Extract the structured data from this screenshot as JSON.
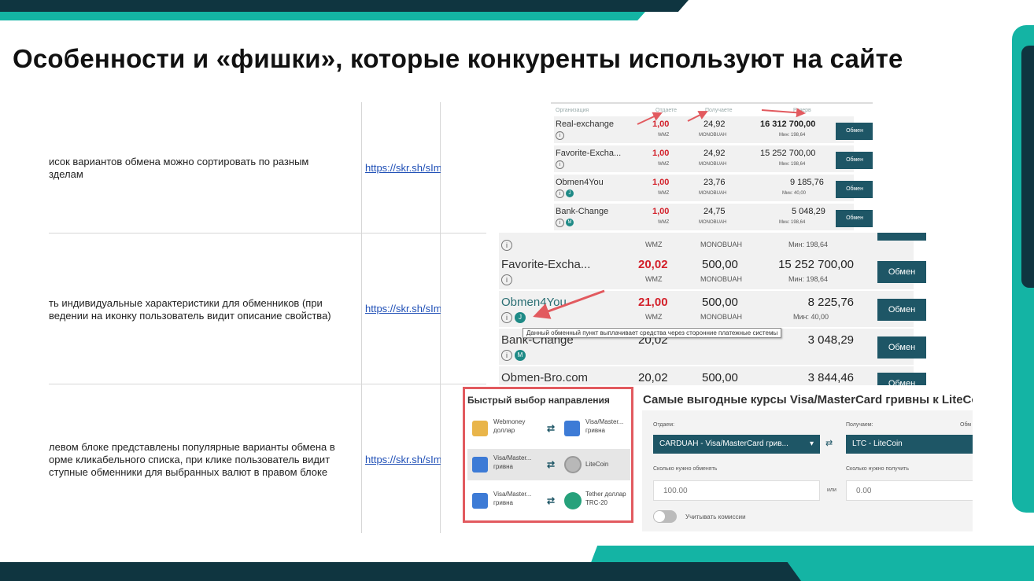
{
  "slide": {
    "title": "Особенности и «фишки», которые конкуренты используют на сайте"
  },
  "rows": [
    {
      "description": "исок вариантов обмена можно сортировать по разным\nзделам",
      "link": "https://skr.sh/sIm"
    },
    {
      "description": "ть индивидуальные характеристики для обменников (при\nведении на иконку пользователь видит описание свойства)",
      "link": "https://skr.sh/sIm"
    },
    {
      "description": "левом блоке представлены популярные варианты обмена в\nорме кликабельного списка, при клике пользователь видит\nступные обменники для выбранных валют в правом блоке",
      "link": "https://skr.sh/sIm"
    }
  ],
  "shot1": {
    "headers": [
      "Организация",
      "Отдаете",
      "Получаете",
      "Резерв"
    ],
    "rows": [
      {
        "org": "Real-exchange",
        "give": "1,00",
        "give_cur": "WMZ",
        "get": "24,92",
        "get_cur": "MONOBUAH",
        "reserve": "16 312 700,00",
        "min": "Мин: 198,64",
        "button": "Обмен",
        "badge": ""
      },
      {
        "org": "Favorite-Excha...",
        "give": "1,00",
        "give_cur": "WMZ",
        "get": "24,92",
        "get_cur": "MONOBUAH",
        "reserve": "15 252 700,00",
        "min": "Мин: 198,64",
        "button": "Обмен",
        "badge": ""
      },
      {
        "org": "Obmen4You",
        "give": "1,00",
        "give_cur": "WMZ",
        "get": "23,76",
        "get_cur": "MONOBUAH",
        "reserve": "9 185,76",
        "min": "Мин: 40,00",
        "button": "Обмен",
        "badge": "J"
      },
      {
        "org": "Bank-Change",
        "give": "1,00",
        "give_cur": "WMZ",
        "get": "24,75",
        "get_cur": "MONOBUAH",
        "reserve": "5 048,29",
        "min": "Мин: 198,64",
        "button": "Обмен",
        "badge": "M"
      }
    ]
  },
  "shot2": {
    "rows": [
      {
        "org": "",
        "give": "",
        "give_cur": "WMZ",
        "get": "",
        "get_cur": "MONOBUAH",
        "reserve": "",
        "min": "Мин: 198,64",
        "button": "Обмен",
        "badge": ""
      },
      {
        "org": "Favorite-Excha...",
        "give": "20,02",
        "give_cur": "WMZ",
        "get": "500,00",
        "get_cur": "MONOBUAH",
        "reserve": "15 252 700,00",
        "min": "Мин: 198,64",
        "button": "Обмен",
        "badge": ""
      },
      {
        "org": "Obmen4You",
        "give": "21,00",
        "give_cur": "WMZ",
        "get": "500,00",
        "get_cur": "MONOBUAH",
        "reserve": "8 225,76",
        "min": "Мин: 40,00",
        "button": "Обмен",
        "badge": "J"
      },
      {
        "org": "Bank-Change",
        "give": "20,02",
        "give_cur": "",
        "get": "",
        "get_cur": "",
        "reserve": "3 048,29",
        "min": "",
        "button": "Обмен",
        "badge": "M"
      },
      {
        "org": "Obmen-Bro.com",
        "give": "20,02",
        "give_cur": "",
        "get": "500,00",
        "get_cur": "",
        "reserve": "3 844,46",
        "min": "",
        "button": "Обмен",
        "badge": ""
      }
    ],
    "tooltip": "Данный обменный пункт выплачивает средства через сторонние платежные системы"
  },
  "quick": {
    "title": "Быстрый выбор направления",
    "items": [
      {
        "from": "Webmoney доллар",
        "to": "Visa/Master... гривна"
      },
      {
        "from": "Visa/Master... гривна",
        "to": "LiteCoin"
      },
      {
        "from": "Visa/Master... гривна",
        "to": "Tether доллар TRC-20"
      }
    ]
  },
  "rates": {
    "title": "Самые выгодные курсы Visa/MasterCard гривны к LiteCo",
    "give_label": "Отдаем:",
    "get_label": "Получаем:",
    "extra_label": "Обм",
    "give_select": "CARDUAH - Visa/MasterCard грив...",
    "get_select": "LTC - LiteCoin",
    "amount_give_label": "Сколько нужно обменять",
    "amount_get_label": "Сколько нужно получить",
    "amount_give": "100.00",
    "amount_get": "0.00",
    "or": "или",
    "commission": "Учитывать комиссии"
  },
  "colors": {
    "dark_teal": "#0f3540",
    "teal": "#14b4a4",
    "button": "#1e5666",
    "red_value": "#d3202a",
    "highlight_border": "#e25a5f",
    "arrow": "#e25a5f"
  }
}
